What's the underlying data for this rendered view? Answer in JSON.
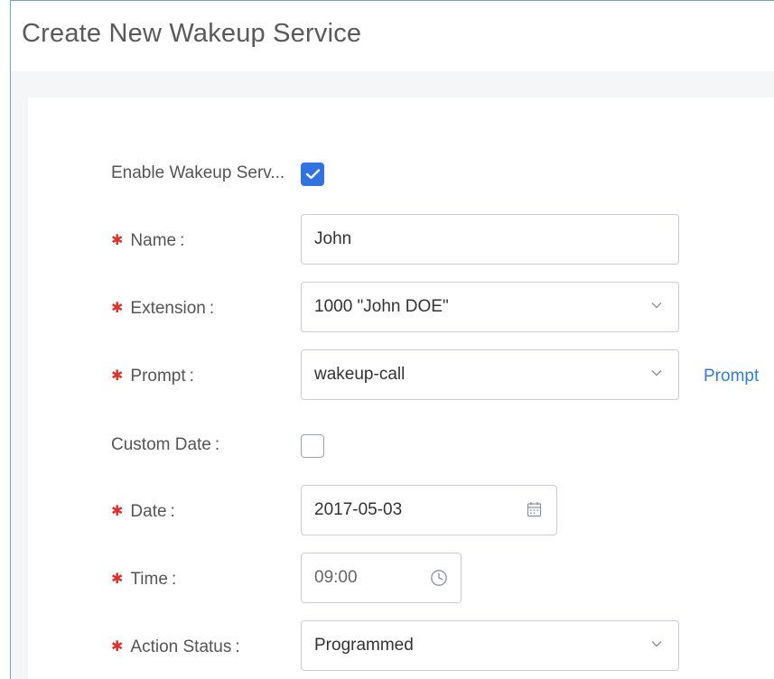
{
  "header": {
    "title": "Create New Wakeup Service"
  },
  "form": {
    "enable": {
      "label": "Enable Wakeup Serv...",
      "checked": true
    },
    "name": {
      "label": "Name",
      "value": "John"
    },
    "extension": {
      "label": "Extension",
      "value": "1000 \"John DOE\""
    },
    "prompt": {
      "label": "Prompt",
      "value": "wakeup-call",
      "link": "Prompt"
    },
    "custom_date": {
      "label": "Custom Date",
      "checked": false
    },
    "date": {
      "label": "Date",
      "value": "2017-05-03"
    },
    "time": {
      "label": "Time",
      "value": "09:00"
    },
    "action_status": {
      "label": "Action Status",
      "value": "Programmed"
    }
  },
  "colors": {
    "accent": "#2f73e0",
    "required": "#e0312c",
    "link": "#2f7fd4"
  }
}
